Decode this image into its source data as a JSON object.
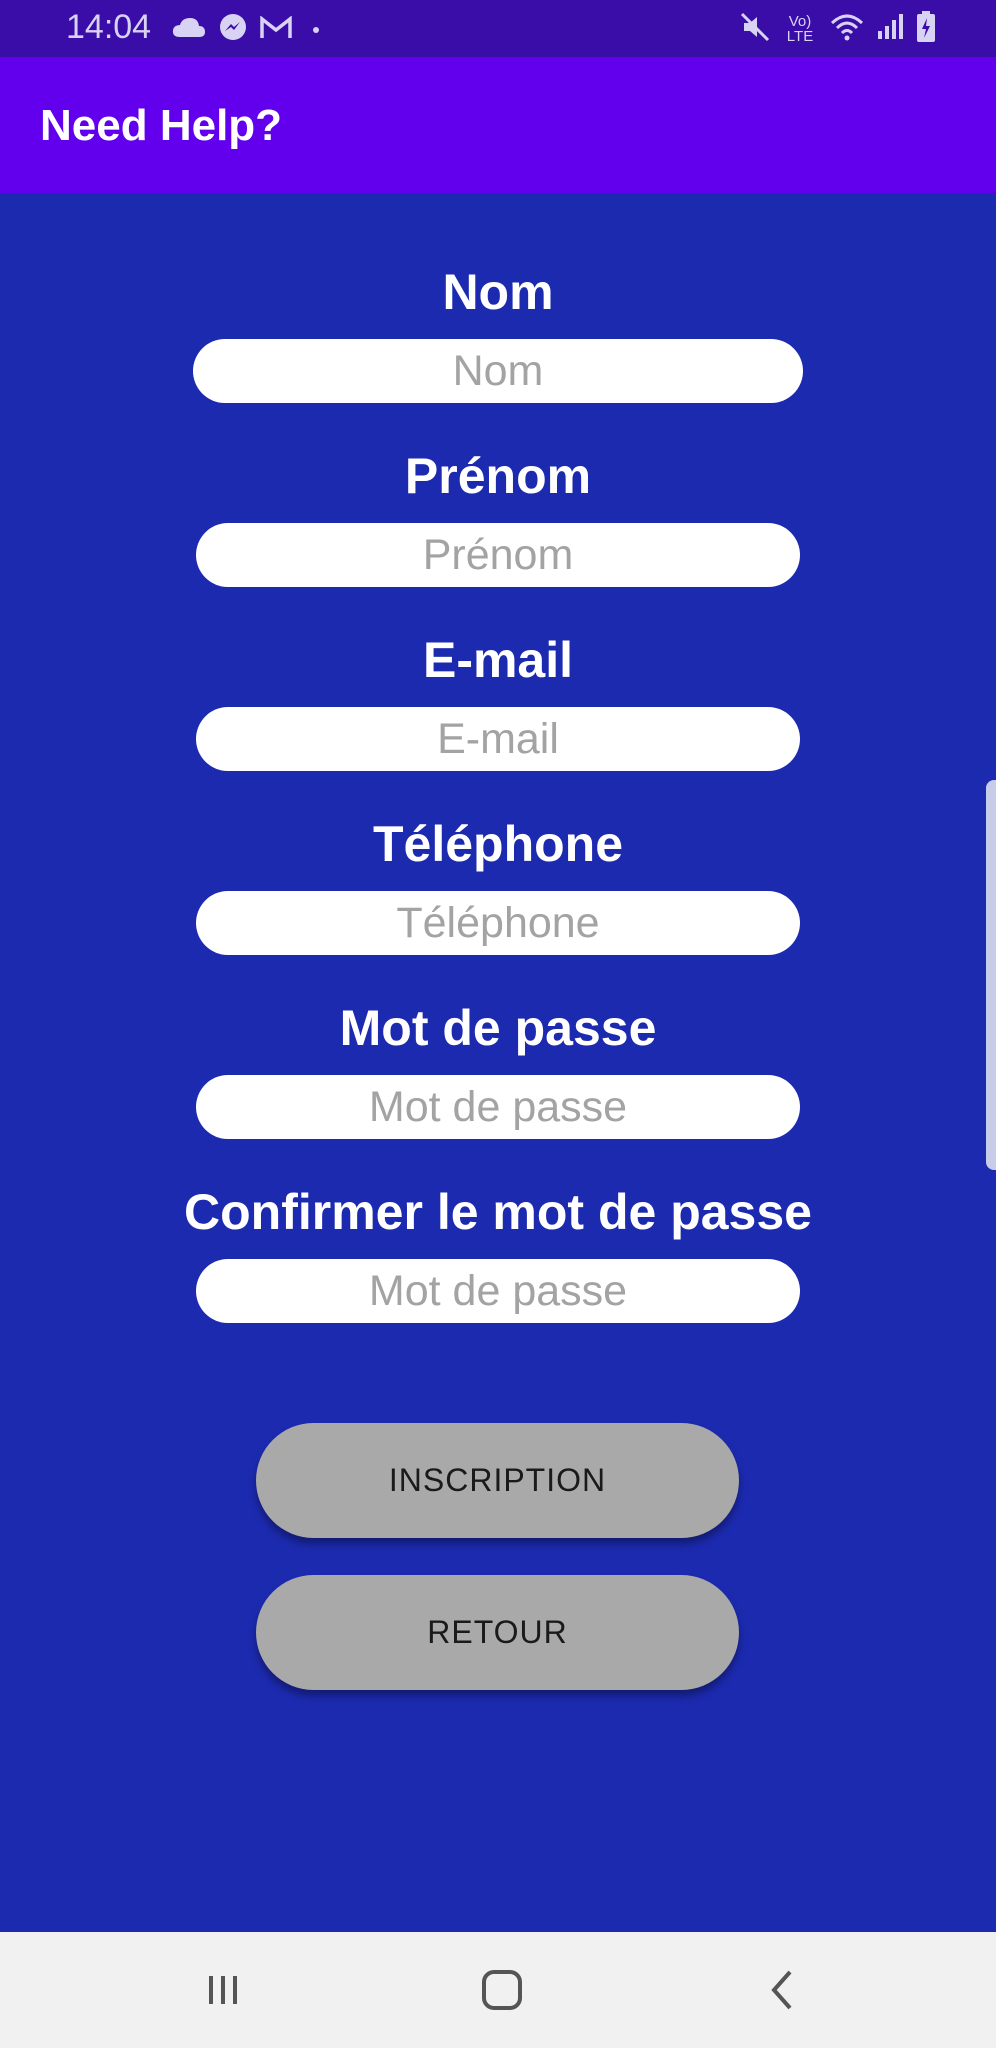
{
  "status_bar": {
    "time": "14:04",
    "left_icons": [
      "cloud-icon",
      "messenger-icon",
      "gmail-icon",
      "dot-icon"
    ],
    "right_icons": [
      "mute-icon",
      "volte-icon",
      "wifi-icon",
      "signal-icon",
      "battery-icon"
    ],
    "volte_text": "Vo) LTE"
  },
  "app_bar": {
    "title": "Need Help?"
  },
  "form": {
    "fields": [
      {
        "label": "Nom",
        "placeholder": "Nom"
      },
      {
        "label": "Prénom",
        "placeholder": "Prénom"
      },
      {
        "label": "E-mail",
        "placeholder": "E-mail"
      },
      {
        "label": "Téléphone",
        "placeholder": "Téléphone"
      },
      {
        "label": "Mot de passe",
        "placeholder": "Mot de passe"
      },
      {
        "label": "Confirmer le mot de passe",
        "placeholder": "Mot de passe"
      }
    ]
  },
  "buttons": {
    "inscription": "INSCRIPTION",
    "retour": "RETOUR"
  },
  "nav_bar": {
    "icons": [
      "recent-apps-icon",
      "home-icon",
      "back-icon"
    ]
  },
  "colors": {
    "background": "#1c2ab0",
    "app_bar": "#6200ee",
    "status_bar": "#3a0ca8",
    "button": "#a9a9a9",
    "nav_bar": "#f1f1f1"
  }
}
